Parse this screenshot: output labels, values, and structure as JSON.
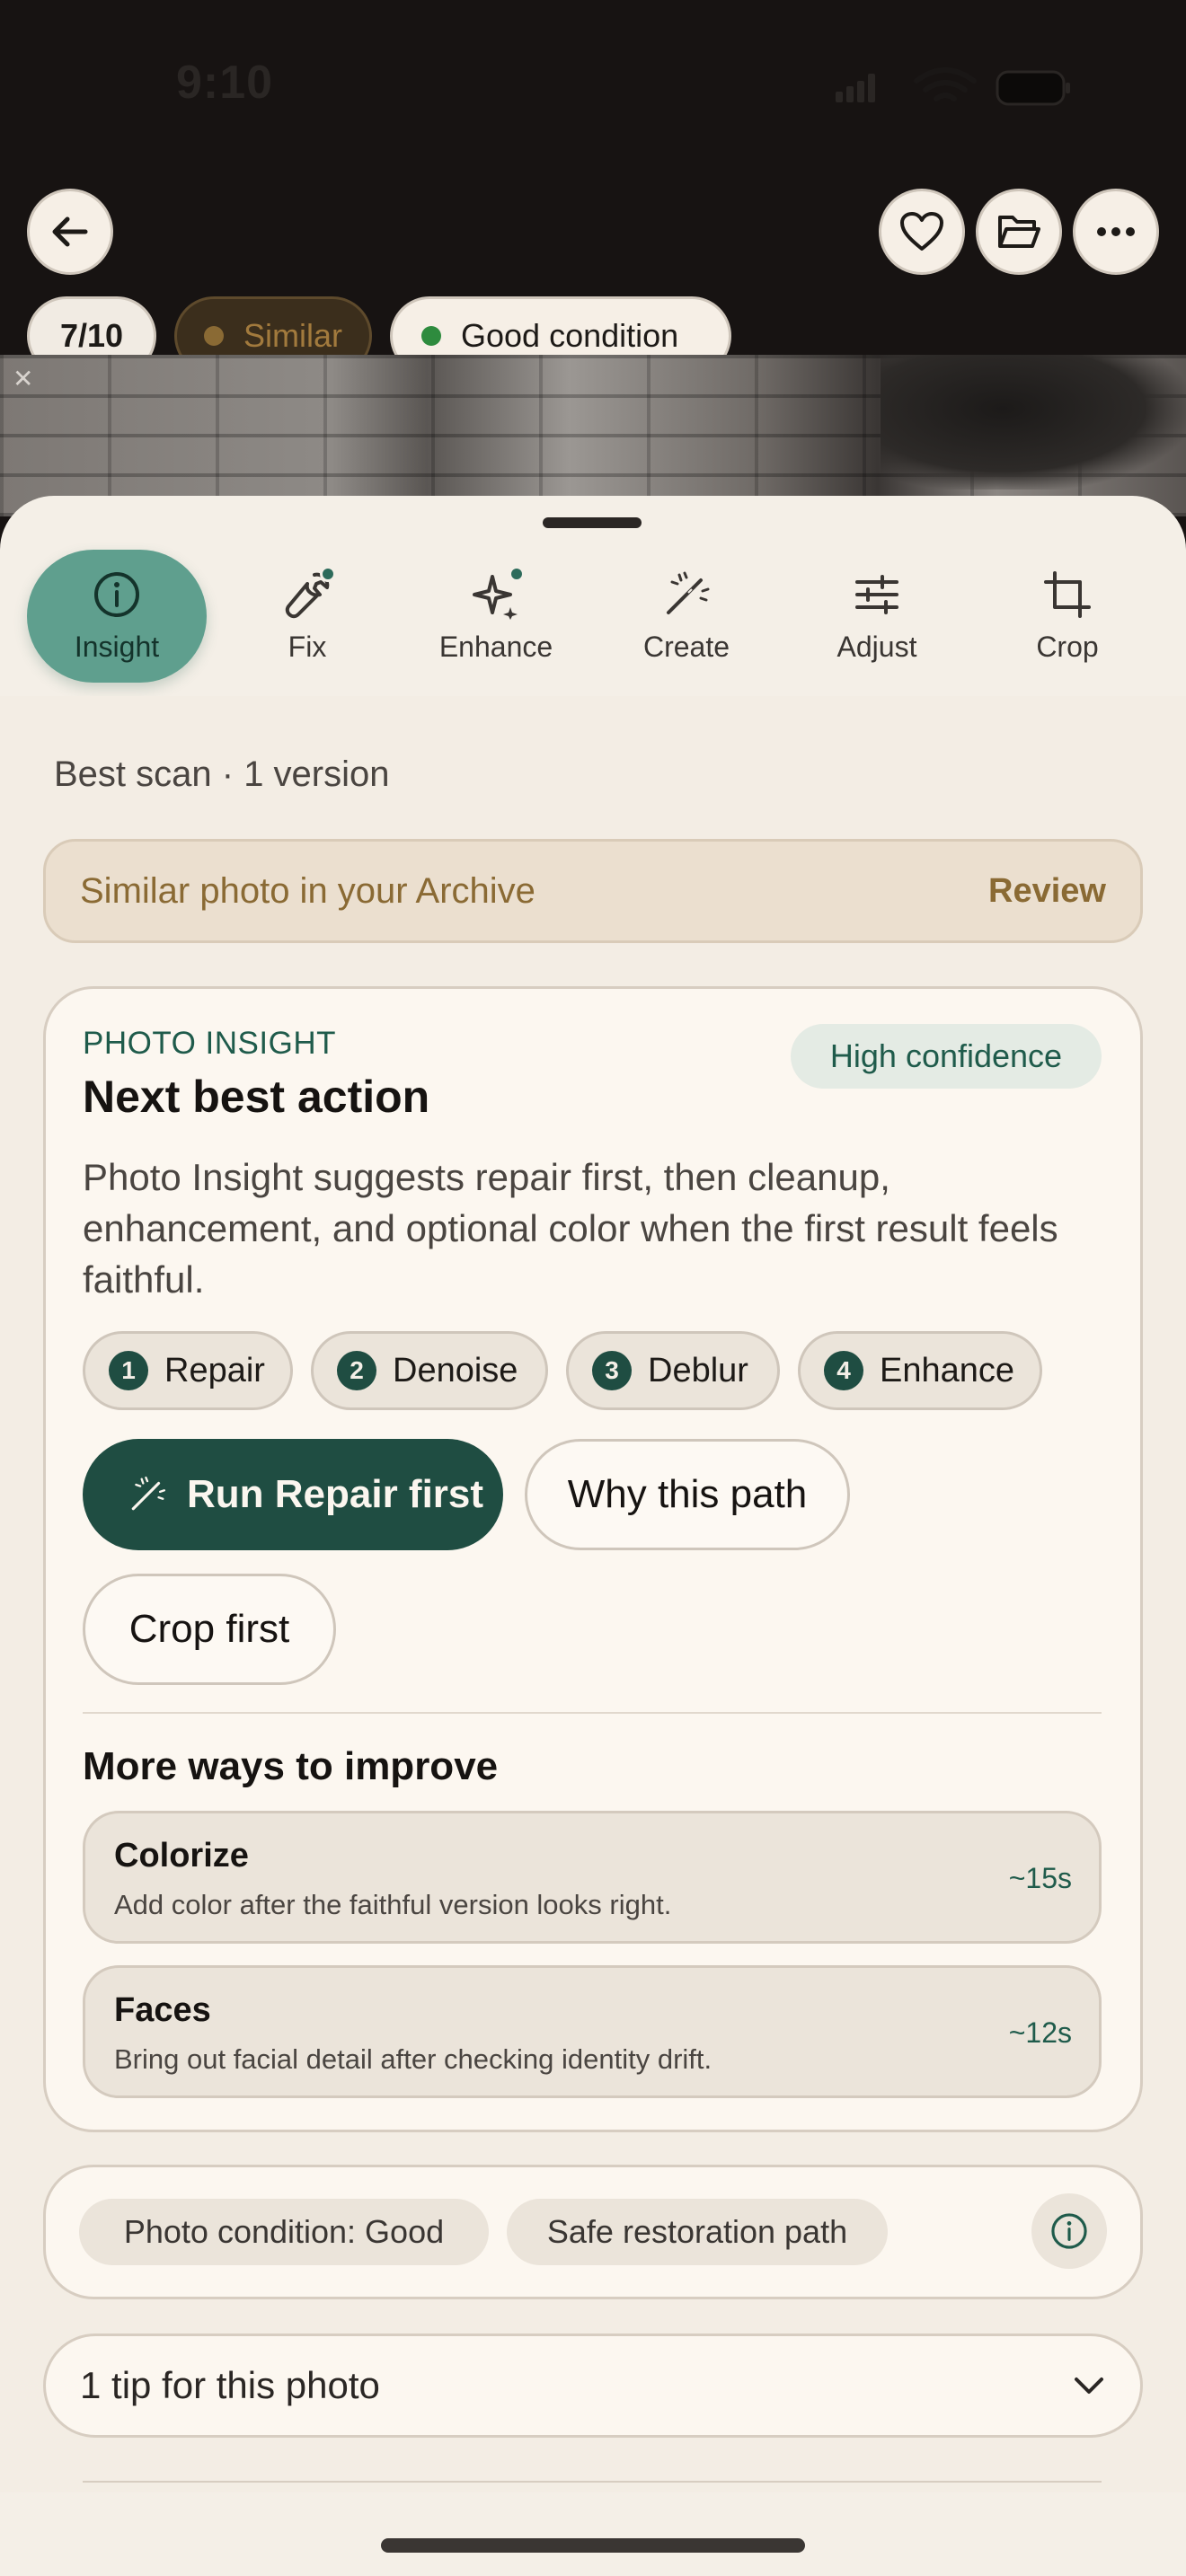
{
  "status_bar": {
    "time": "9:10"
  },
  "header": {
    "counter": "7/10",
    "similar_tag": "Similar",
    "condition_tag": "Good condition"
  },
  "tools": [
    {
      "label": "Insight",
      "icon": "info-icon",
      "active": true
    },
    {
      "label": "Fix",
      "icon": "wrench-icon"
    },
    {
      "label": "Enhance",
      "icon": "sparkle-icon"
    },
    {
      "label": "Create",
      "icon": "magic-wand-icon"
    },
    {
      "label": "Adjust",
      "icon": "sliders-icon"
    },
    {
      "label": "Crop",
      "icon": "crop-icon"
    }
  ],
  "meta": "Best scan · 1 version",
  "similar_banner": {
    "text": "Similar photo in your Archive",
    "action": "Review"
  },
  "insight": {
    "kicker": "PHOTO INSIGHT",
    "title": "Next best action",
    "confidence": "High confidence",
    "body": "Photo Insight suggests repair first, then cleanup, enhancement, and optional color when the first result feels faithful.",
    "steps": [
      {
        "num": "1",
        "label": "Repair"
      },
      {
        "num": "2",
        "label": "Denoise"
      },
      {
        "num": "3",
        "label": "Deblur"
      },
      {
        "num": "4",
        "label": "Enhance"
      }
    ],
    "primary_action": "Run Repair first",
    "secondary_action": "Why this path",
    "tertiary_action": "Crop first",
    "more_title": "More ways to improve",
    "more": [
      {
        "name": "Colorize",
        "desc": "Add color after the faithful version looks right.",
        "time": "~15s"
      },
      {
        "name": "Faces",
        "desc": "Bring out facial detail after checking identity drift.",
        "time": "~12s"
      }
    ]
  },
  "condition": {
    "chip1": "Photo condition: Good",
    "chip2": "Safe restoration path"
  },
  "tip": {
    "text": "1 tip for this photo"
  },
  "colors": {
    "accent": "#1f4d42",
    "active_tool": "#5f9f8e",
    "similar": "#8a6a34",
    "good_dot": "#2e8b3e"
  }
}
